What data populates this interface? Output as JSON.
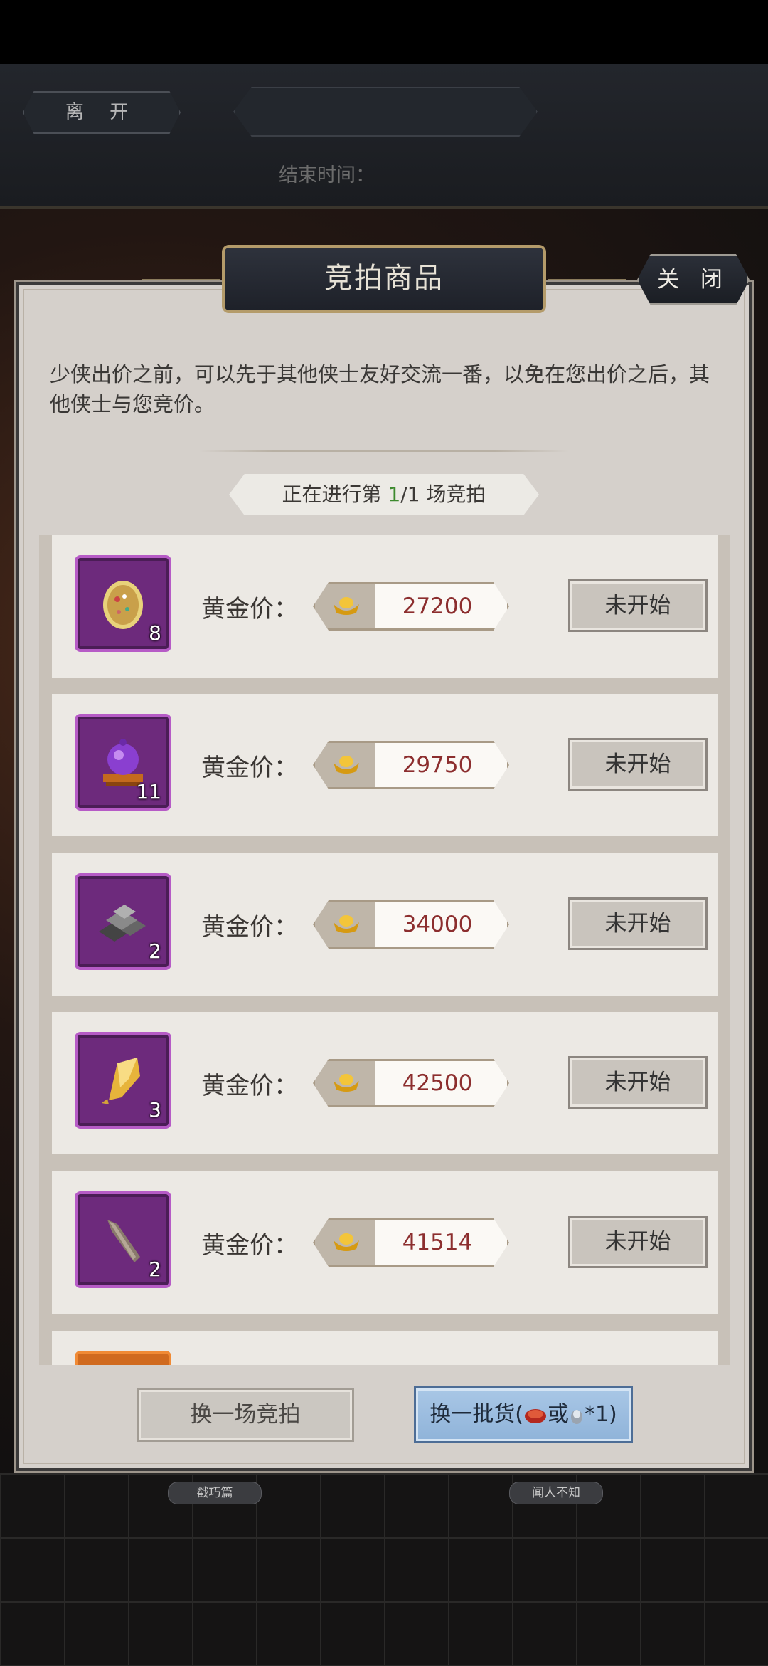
{
  "top_bar": {
    "leave_label": "离 开",
    "title": "",
    "end_time_label": "结束时间：",
    "end_time_value": ""
  },
  "modal": {
    "title": "竞拍商品",
    "close_label": "关 闭",
    "intro": "少侠出价之前，可以先于其他侠士友好交流一番，以免在您出价之后，其他侠士与您竞价。",
    "round_prefix": "正在进行第 ",
    "round_current": "1",
    "round_suffix": "/1 场竞拍"
  },
  "items": [
    {
      "icon": "pearl-egg-icon",
      "count": "8",
      "price_label": "黄金价：",
      "price": "27200",
      "state": "未开始"
    },
    {
      "icon": "purple-orb-stand-icon",
      "count": "11",
      "price_label": "黄金价：",
      "price": "29750",
      "state": "未开始"
    },
    {
      "icon": "iron-ingots-icon",
      "count": "2",
      "price_label": "黄金价：",
      "price": "34000",
      "state": "未开始"
    },
    {
      "icon": "gold-ore-icon",
      "count": "3",
      "price_label": "黄金价：",
      "price": "42500",
      "state": "未开始"
    },
    {
      "icon": "stone-blade-icon",
      "count": "2",
      "price_label": "黄金价：",
      "price": "41514",
      "state": "未开始"
    }
  ],
  "buttons": {
    "switch_auction": "换一场竞拍",
    "switch_goods_prefix": "换一批货(",
    "switch_goods_or": "或",
    "switch_goods_suffix": "*1)"
  },
  "scene_tags": {
    "left": "戳巧篇",
    "right": "闻人不知"
  },
  "colors": {
    "modal_bg": "#d5d0cb",
    "title_bg": "#2e323c",
    "item_frame": "#b65bc6",
    "price_text": "#8c2e2e",
    "round_num": "#3d8a2e",
    "blue_button": "#a9c7e6"
  }
}
